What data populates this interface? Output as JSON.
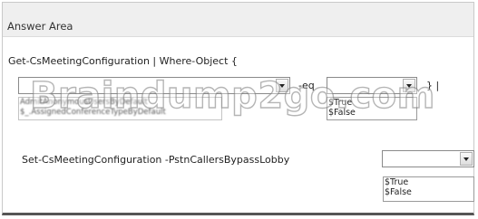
{
  "panel": {
    "title": "Answer Area"
  },
  "line1": {
    "text": "Get-CsMeetingConfiguration | Where-Object {",
    "operator": "-eq",
    "closing": "} |"
  },
  "dropdown1": {
    "value": ""
  },
  "dropdown2": {
    "value": "",
    "options": [
      "$True",
      "$False"
    ]
  },
  "obscured_list": {
    "items": [
      "AdmitAnonymousUsersByDefault",
      "$_.AssignedConferenceTypeByDefault"
    ]
  },
  "line2": {
    "text": "Set-CsMeetingConfiguration  -PstnCallersBypassLobby"
  },
  "dropdown3": {
    "value": "",
    "options": [
      "$True",
      "$False"
    ]
  },
  "watermark": {
    "text": "Braindump2go.com"
  }
}
